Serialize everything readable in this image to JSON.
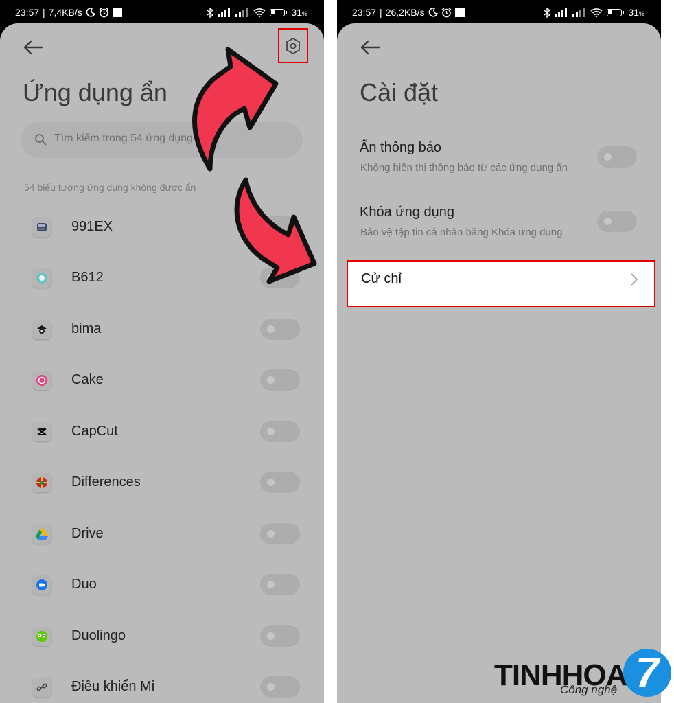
{
  "left_phone": {
    "status": {
      "time": "23:57",
      "speed": "7,4KB/s",
      "battery": "31",
      "battery_unit": "%",
      "battery_level": 0.31
    },
    "title": "Ứng dụng ẩn",
    "search": {
      "placeholder": "Tìm kiếm trong 54 ứng dụng"
    },
    "section_label": "54 biểu tượng ứng dụng không được ẩn",
    "apps": [
      {
        "name": "991EX",
        "icon": "calculator-icon",
        "enabled": false
      },
      {
        "name": "B612",
        "icon": "camera-icon",
        "enabled": false
      },
      {
        "name": "bima",
        "icon": "bima-icon",
        "enabled": false
      },
      {
        "name": "Cake",
        "icon": "cake-icon",
        "enabled": false
      },
      {
        "name": "CapCut",
        "icon": "capcut-icon",
        "enabled": false
      },
      {
        "name": "Differences",
        "icon": "differences-icon",
        "enabled": false
      },
      {
        "name": "Drive",
        "icon": "drive-icon",
        "enabled": false
      },
      {
        "name": "Duo",
        "icon": "video-icon",
        "enabled": false
      },
      {
        "name": "Duolingo",
        "icon": "owl-icon",
        "enabled": false
      },
      {
        "name": "Điều khiển Mi",
        "icon": "link-icon",
        "enabled": false
      }
    ]
  },
  "right_phone": {
    "status": {
      "time": "23:57",
      "speed": "26,2KB/s",
      "battery": "31",
      "battery_unit": "%",
      "battery_level": 0.31
    },
    "title": "Cài đặt",
    "settings": [
      {
        "title": "Ẩn thông báo",
        "subtitle": "Không hiển thị thông báo từ các ứng dụng ẩn",
        "enabled": false
      },
      {
        "title": "Khóa ứng dụng",
        "subtitle": "Bảo vệ tập tin cá nhân bằng Khóa ứng dụng",
        "enabled": false
      }
    ],
    "gesture": {
      "label": "Cử chỉ"
    }
  },
  "logo": {
    "text": "TINHHOA",
    "subtext": "Công nghệ",
    "badge": "7"
  },
  "colors": {
    "highlight": "#e00000",
    "arrow": "#f0374f",
    "overlay": "#bbbbbb",
    "logo_blue": "#1b8fe0"
  }
}
